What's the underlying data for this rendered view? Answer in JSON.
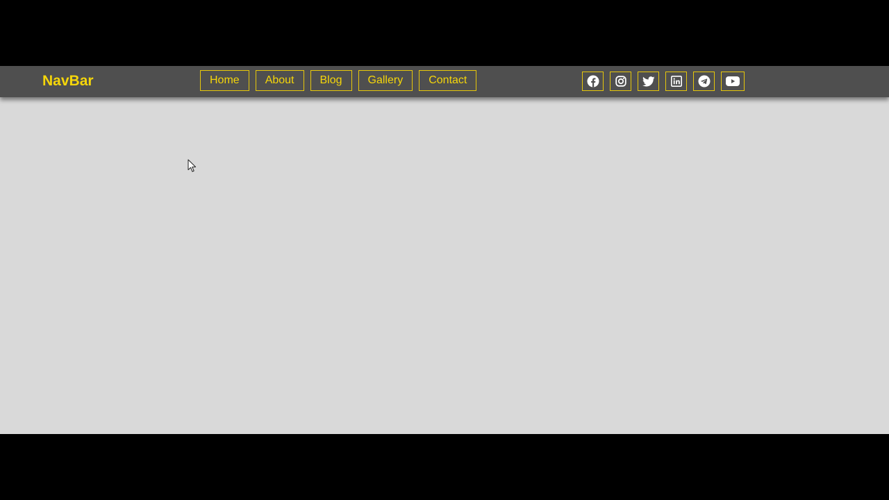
{
  "navbar": {
    "brand": "NavBar",
    "links": [
      "Home",
      "About",
      "Blog",
      "Gallery",
      "Contact"
    ],
    "socials": [
      "facebook-icon",
      "instagram-icon",
      "twitter-icon",
      "linkedin-icon",
      "telegram-icon",
      "youtube-icon"
    ]
  },
  "colors": {
    "accent": "#f5d60a",
    "navbar_bg": "#4f4f4f",
    "page_bg": "#d9d9d9",
    "letterbox": "#000000"
  }
}
